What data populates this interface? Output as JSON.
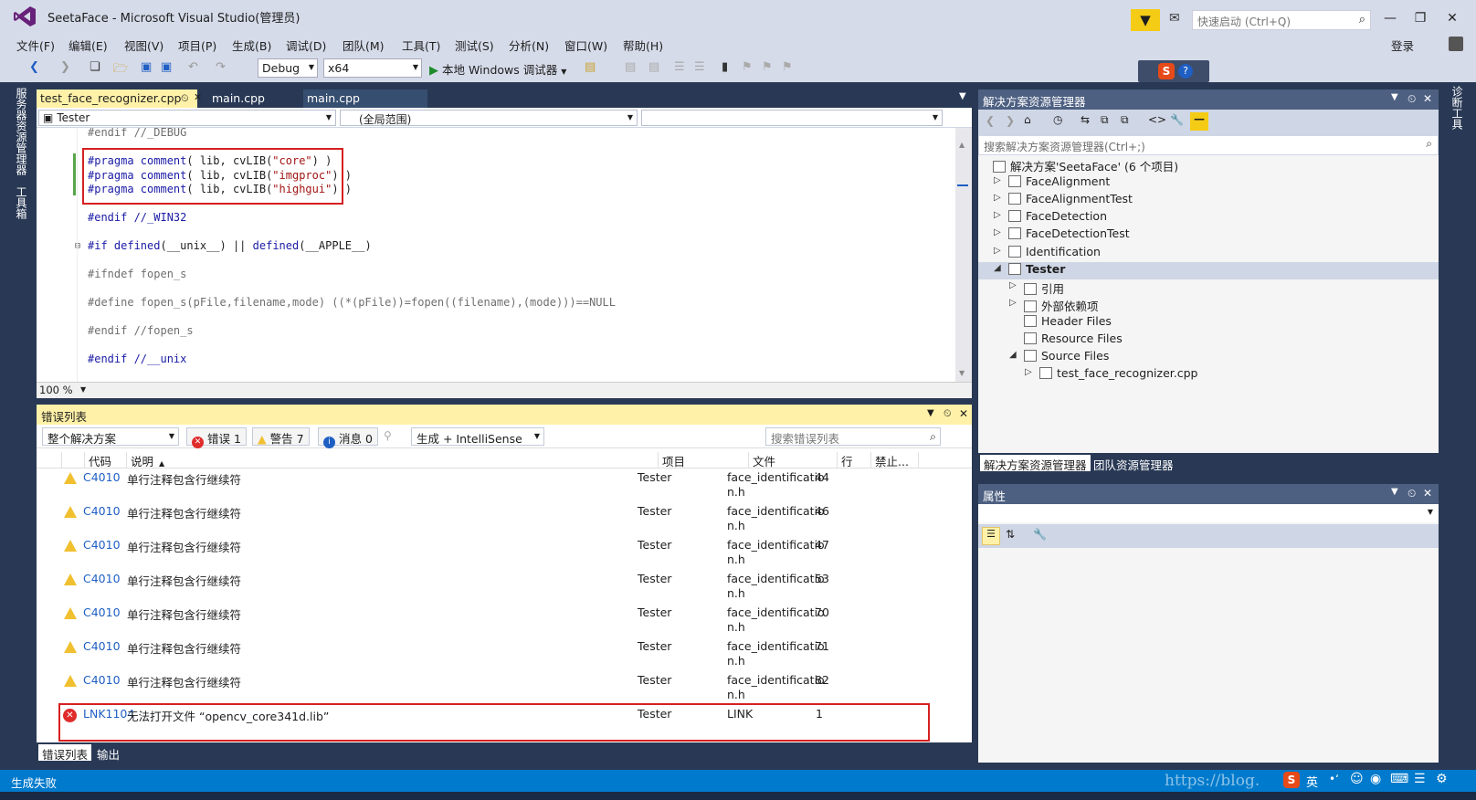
{
  "window": {
    "title": "SeetaFace - Microsoft Visual Studio(管理员)",
    "quick_launch_placeholder": "快速启动 (Ctrl+Q)"
  },
  "menu": [
    "文件(F)",
    "编辑(E)",
    "视图(V)",
    "项目(P)",
    "生成(B)",
    "调试(D)",
    "团队(M)",
    "工具(T)",
    "测试(S)",
    "分析(N)",
    "窗口(W)",
    "帮助(H)"
  ],
  "account": {
    "login_label": "登录"
  },
  "toolbar": {
    "config": "Debug",
    "platform": "x64",
    "debug_target": "本地 Windows 调试器"
  },
  "left_strip": {
    "server_explorer": "服务器资源管理器",
    "toolbox": "工具箱"
  },
  "right_strip": {
    "diagnostics": "诊断工具"
  },
  "editor": {
    "tabs": [
      "test_face_recognizer.cpp",
      "main.cpp",
      "main.cpp"
    ],
    "nav_project": "Tester",
    "nav_scope": "(全局范围)",
    "zoom": "100 %",
    "lines": [
      {
        "segments": [
          {
            "t": "#endif //_DEBUG",
            "c": "pp"
          }
        ]
      },
      {
        "segments": []
      },
      {
        "segments": [
          {
            "t": "#pragma ",
            "c": "kw"
          },
          {
            "t": "comment",
            "c": "kw"
          },
          {
            "t": "( lib, cvLIB(",
            "c": ""
          },
          {
            "t": "\"core\"",
            "c": "str"
          },
          {
            "t": ") )",
            "c": ""
          }
        ]
      },
      {
        "segments": [
          {
            "t": "#pragma ",
            "c": "kw"
          },
          {
            "t": "comment",
            "c": "kw"
          },
          {
            "t": "( lib, cvLIB(",
            "c": ""
          },
          {
            "t": "\"imgproc\"",
            "c": "str"
          },
          {
            "t": ") )",
            "c": ""
          }
        ]
      },
      {
        "segments": [
          {
            "t": "#pragma ",
            "c": "kw"
          },
          {
            "t": "comment",
            "c": "kw"
          },
          {
            "t": "( lib, cvLIB(",
            "c": ""
          },
          {
            "t": "\"highgui\"",
            "c": "str"
          },
          {
            "t": ") )",
            "c": ""
          }
        ]
      },
      {
        "segments": []
      },
      {
        "segments": [
          {
            "t": "#endif //_WIN32",
            "c": "kw"
          }
        ]
      },
      {
        "segments": []
      },
      {
        "segments": [
          {
            "t": "#if ",
            "c": "kw"
          },
          {
            "t": "defined",
            "c": "kw"
          },
          {
            "t": "(__unix__) || ",
            "c": ""
          },
          {
            "t": "defined",
            "c": "kw"
          },
          {
            "t": "(__APPLE__)",
            "c": ""
          }
        ]
      },
      {
        "segments": []
      },
      {
        "segments": [
          {
            "t": "#ifndef fopen_s",
            "c": "pp"
          }
        ]
      },
      {
        "segments": []
      },
      {
        "segments": [
          {
            "t": "#define fopen_s(pFile,filename,mode) ((*(pFile))=fopen((filename),(mode)))==NULL",
            "c": "pp"
          }
        ]
      },
      {
        "segments": []
      },
      {
        "segments": [
          {
            "t": "#endif //fopen_s",
            "c": "pp"
          }
        ]
      },
      {
        "segments": []
      },
      {
        "segments": [
          {
            "t": "#endif //__unix",
            "c": "kw"
          }
        ]
      }
    ]
  },
  "error_list": {
    "title": "错误列表",
    "scope": "整个解决方案",
    "errors_btn": "错误 1",
    "warnings_btn": "警告 7",
    "messages_btn": "消息 0",
    "build_filter": "生成 + IntelliSense",
    "search_placeholder": "搜索错误列表",
    "columns": [
      "代码",
      "说明",
      "项目",
      "文件",
      "行",
      "禁止..."
    ],
    "rows": [
      {
        "kind": "warn",
        "code": "C4010",
        "desc": "单行注释包含行继续符",
        "project": "Tester",
        "file": "face_identificatio",
        "file2": "n.h",
        "line": "44"
      },
      {
        "kind": "warn",
        "code": "C4010",
        "desc": "单行注释包含行继续符",
        "project": "Tester",
        "file": "face_identificatio",
        "file2": "n.h",
        "line": "46"
      },
      {
        "kind": "warn",
        "code": "C4010",
        "desc": "单行注释包含行继续符",
        "project": "Tester",
        "file": "face_identificatio",
        "file2": "n.h",
        "line": "47"
      },
      {
        "kind": "warn",
        "code": "C4010",
        "desc": "单行注释包含行继续符",
        "project": "Tester",
        "file": "face_identificatio",
        "file2": "n.h",
        "line": "53"
      },
      {
        "kind": "warn",
        "code": "C4010",
        "desc": "单行注释包含行继续符",
        "project": "Tester",
        "file": "face_identificatio",
        "file2": "n.h",
        "line": "70"
      },
      {
        "kind": "warn",
        "code": "C4010",
        "desc": "单行注释包含行继续符",
        "project": "Tester",
        "file": "face_identificatio",
        "file2": "n.h",
        "line": "71"
      },
      {
        "kind": "warn",
        "code": "C4010",
        "desc": "单行注释包含行继续符",
        "project": "Tester",
        "file": "face_identificatio",
        "file2": "n.h",
        "line": "82"
      },
      {
        "kind": "error",
        "code": "LNK1104",
        "desc": "无法打开文件 “opencv_core341d.lib”",
        "project": "Tester",
        "file": "LINK",
        "file2": "",
        "line": "1"
      }
    ],
    "bottom_tabs": [
      "错误列表",
      "输出"
    ]
  },
  "solution_explorer": {
    "title": "解决方案资源管理器",
    "search_placeholder": "搜索解决方案资源管理器(Ctrl+;)",
    "tree": [
      {
        "label": "解决方案'SeetaFace' (6 个项目)",
        "level": 0,
        "twisty": "",
        "sel": false,
        "bold": false
      },
      {
        "label": "FaceAlignment",
        "level": 1,
        "twisty": "▷",
        "sel": false,
        "bold": false
      },
      {
        "label": "FaceAlignmentTest",
        "level": 1,
        "twisty": "▷",
        "sel": false,
        "bold": false
      },
      {
        "label": "FaceDetection",
        "level": 1,
        "twisty": "▷",
        "sel": false,
        "bold": false
      },
      {
        "label": "FaceDetectionTest",
        "level": 1,
        "twisty": "▷",
        "sel": false,
        "bold": false
      },
      {
        "label": "Identification",
        "level": 1,
        "twisty": "▷",
        "sel": false,
        "bold": false
      },
      {
        "label": "Tester",
        "level": 1,
        "twisty": "◢",
        "sel": true,
        "bold": true
      },
      {
        "label": "引用",
        "level": 2,
        "twisty": "▷",
        "sel": false,
        "bold": false
      },
      {
        "label": "外部依赖项",
        "level": 2,
        "twisty": "▷",
        "sel": false,
        "bold": false
      },
      {
        "label": "Header Files",
        "level": 2,
        "twisty": "",
        "sel": false,
        "bold": false
      },
      {
        "label": "Resource Files",
        "level": 2,
        "twisty": "",
        "sel": false,
        "bold": false
      },
      {
        "label": "Source Files",
        "level": 2,
        "twisty": "◢",
        "sel": false,
        "bold": false
      },
      {
        "label": "test_face_recognizer.cpp",
        "level": 3,
        "twisty": "▷",
        "sel": false,
        "bold": false
      }
    ],
    "tabs": [
      "解决方案资源管理器",
      "团队资源管理器"
    ]
  },
  "properties": {
    "title": "属性"
  },
  "status": {
    "text": "生成失败",
    "watermark": "https://blog."
  },
  "colors": {
    "accent": "#007acc",
    "warning": "#f0c030",
    "error": "#e02b2b",
    "highlight_box": "#d62020"
  }
}
